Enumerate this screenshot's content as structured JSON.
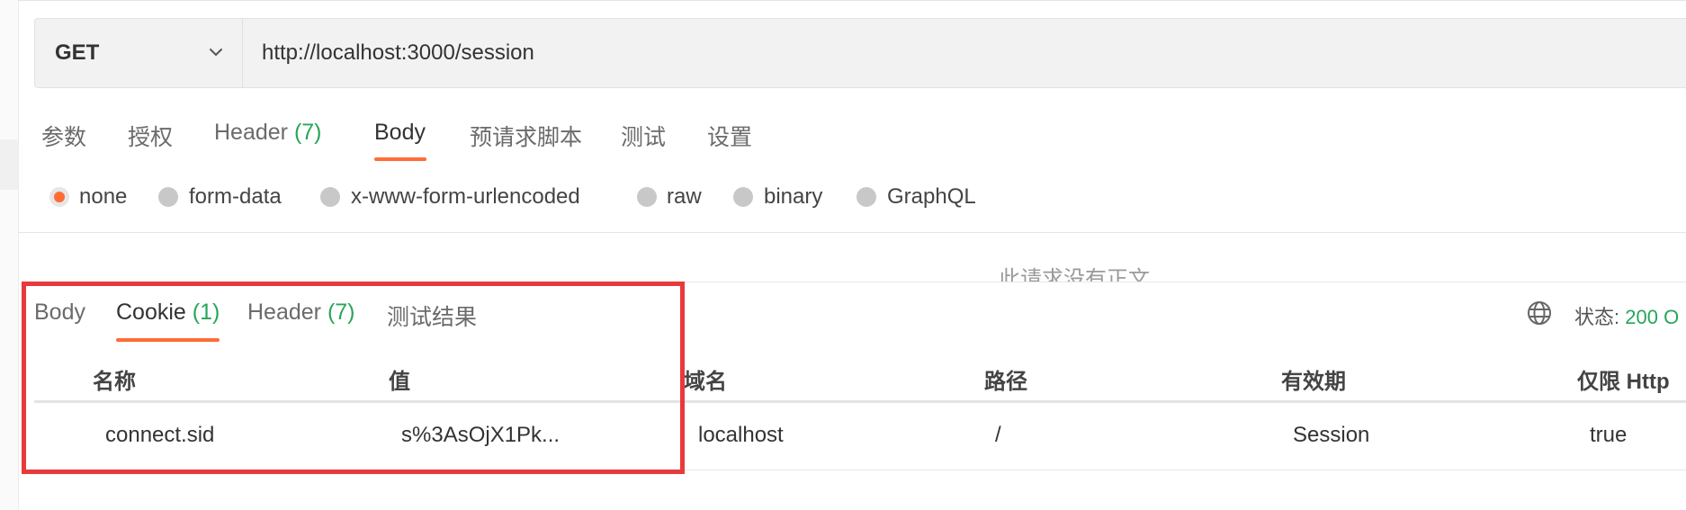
{
  "request": {
    "method": "GET",
    "url": "http://localhost:3000/session"
  },
  "request_tabs": [
    {
      "label": "参数"
    },
    {
      "label": "授权"
    },
    {
      "label": "Header",
      "count": "(7)"
    },
    {
      "label": "Body",
      "active": true
    },
    {
      "label": "预请求脚本"
    },
    {
      "label": "测试"
    },
    {
      "label": "设置"
    }
  ],
  "body_types": [
    {
      "label": "none",
      "checked": true
    },
    {
      "label": "form-data"
    },
    {
      "label": "x-www-form-urlencoded"
    },
    {
      "label": "raw"
    },
    {
      "label": "binary"
    },
    {
      "label": "GraphQL"
    }
  ],
  "no_body_message": "此请求没有正文",
  "response_tabs": [
    {
      "label": "Body"
    },
    {
      "label": "Cookie",
      "count": "(1)",
      "active": true
    },
    {
      "label": "Header",
      "count": "(7)"
    },
    {
      "label": "测试结果"
    }
  ],
  "status": {
    "label": "状态:",
    "value": "200 O"
  },
  "cookie_table": {
    "headers": [
      "名称",
      "值",
      "域名",
      "路径",
      "有效期",
      "仅限 Http"
    ],
    "rows": [
      [
        "connect.sid",
        "s%3AsOjX1Pk...",
        "localhost",
        "/",
        "Session",
        "true"
      ]
    ]
  },
  "colors": {
    "accent": "#ff6c37",
    "count_green": "#27a65a",
    "highlight_red": "#e8393b"
  },
  "icons": {
    "method_dropdown": "chevron-down-icon",
    "network": "globe-icon"
  }
}
